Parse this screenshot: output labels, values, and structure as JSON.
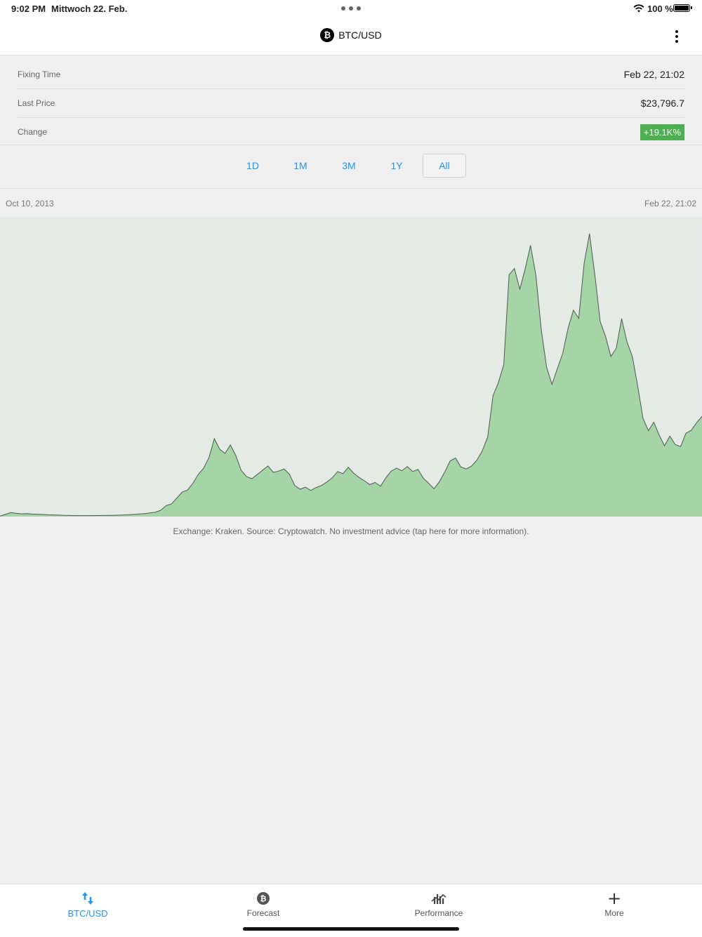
{
  "status_bar": {
    "time": "9:02 PM",
    "date": "Mittwoch 22. Feb.",
    "battery_pct": "100 %"
  },
  "nav": {
    "title": "BTC/USD",
    "coin_icon": "bitcoin-icon",
    "menu_icon": "more-vertical-icon"
  },
  "info": {
    "fixing_time_label": "Fixing Time",
    "fixing_time_value": "Feb 22, 21:02",
    "last_price_label": "Last Price",
    "last_price_value": "$23,796.7",
    "change_label": "Change",
    "change_value": "+19.1K%",
    "change_color": "#4caf50"
  },
  "ranges": {
    "options": [
      "1D",
      "1M",
      "3M",
      "1Y",
      "All"
    ],
    "selected": "All",
    "accent": "#2196f3"
  },
  "chart_data": {
    "type": "area",
    "x_start_label": "Oct 10, 2013",
    "x_end_label": "Feb 22, 21:02",
    "fill_color": "#a5d4a6",
    "line_color": "#555555",
    "ylim": [
      0,
      69000
    ],
    "values": [
      123,
      520,
      950,
      780,
      650,
      700,
      600,
      550,
      500,
      420,
      380,
      350,
      300,
      260,
      240,
      230,
      230,
      240,
      250,
      260,
      280,
      300,
      330,
      380,
      440,
      520,
      610,
      700,
      880,
      1050,
      1500,
      2600,
      3000,
      4400,
      5800,
      6300,
      7900,
      10000,
      11500,
      14000,
      18500,
      16000,
      15000,
      17000,
      14500,
      11000,
      9500,
      9000,
      10000,
      11000,
      12000,
      10500,
      10800,
      11300,
      10100,
      7400,
      6500,
      7000,
      6200,
      6900,
      7400,
      8200,
      9200,
      10700,
      10200,
      11700,
      10300,
      9300,
      8500,
      7600,
      8100,
      7200,
      9200,
      10800,
      11500,
      10900,
      11900,
      10700,
      11200,
      9100,
      7900,
      6600,
      8300,
      10600,
      13200,
      13900,
      11800,
      11300,
      12000,
      13400,
      15600,
      18900,
      28700,
      31800,
      36100,
      57400,
      58900,
      54000,
      58800,
      64400,
      57300,
      44400,
      35500,
      31400,
      35100,
      38700,
      44700,
      49000,
      47100,
      60100,
      67200,
      57500,
      46300,
      42800,
      38000,
      40000,
      47000,
      41500,
      38000,
      31000,
      23300,
      20400,
      22400,
      19400,
      16800,
      19100,
      17100,
      16600,
      19800,
      20500,
      22300,
      23796
    ]
  },
  "disclaimer": "Exchange: Kraken. Source: Cryptowatch. No investment advice (tap here for more information).",
  "tabs": [
    {
      "label": "BTC/USD",
      "icon": "swap-arrows-icon",
      "active": true
    },
    {
      "label": "Forecast",
      "icon": "bitcoin-icon",
      "active": false
    },
    {
      "label": "Performance",
      "icon": "performance-chart-icon",
      "active": false
    },
    {
      "label": "More",
      "icon": "plus-icon",
      "active": false
    }
  ]
}
